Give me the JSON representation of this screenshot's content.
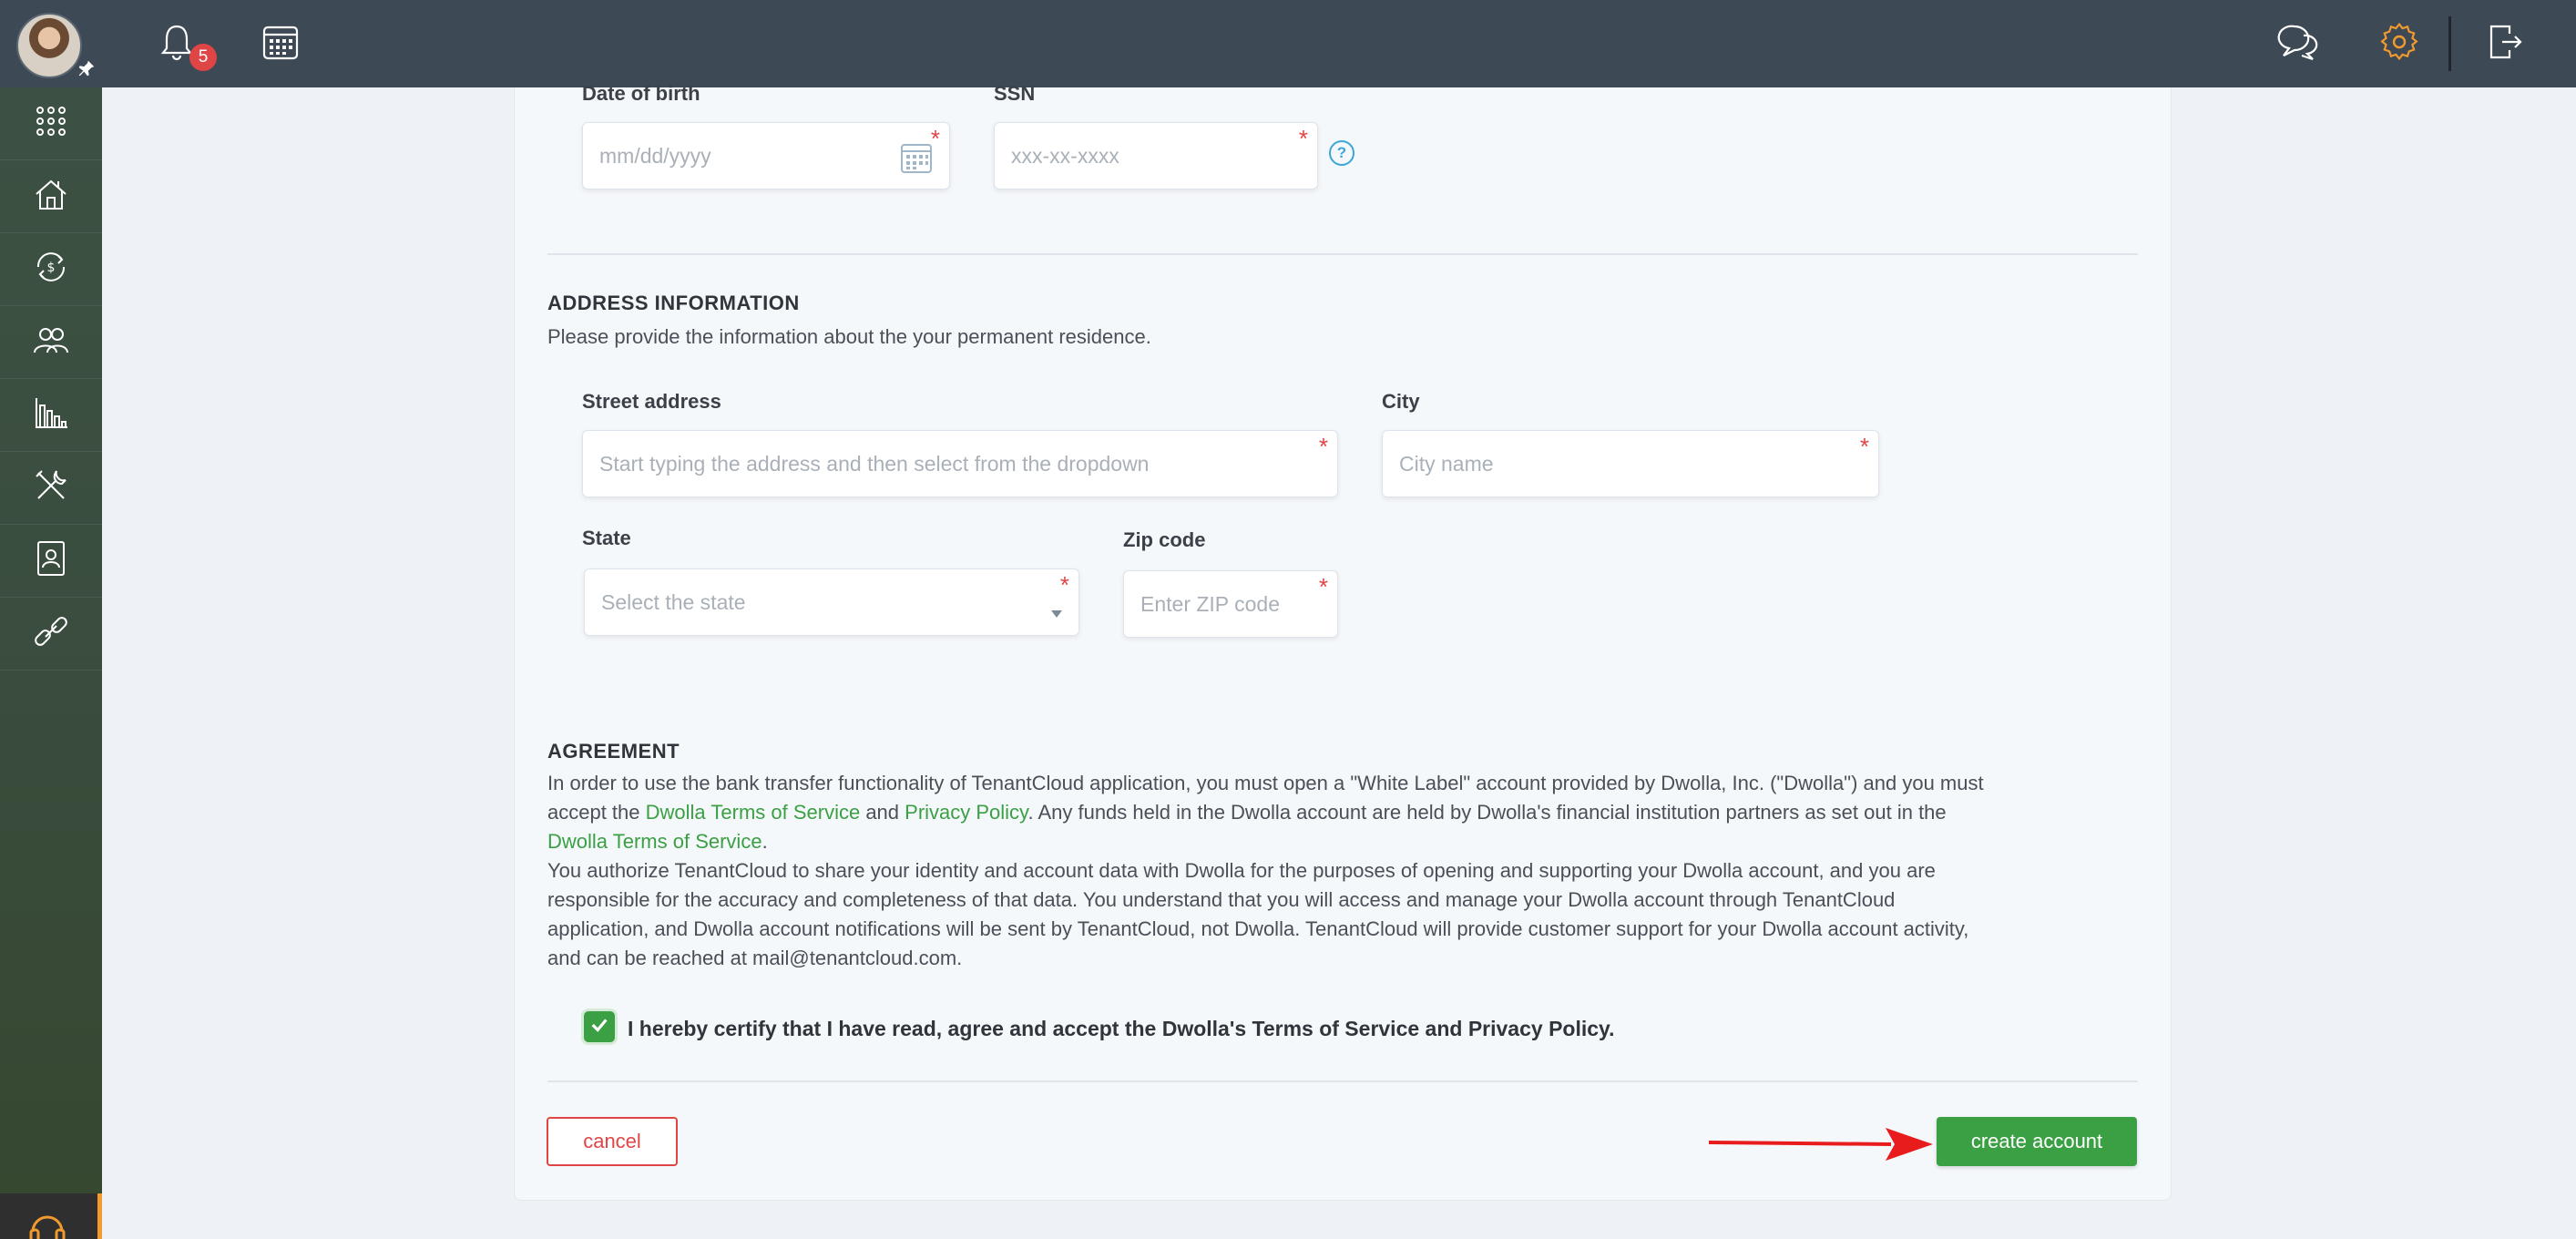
{
  "topbar": {
    "notifications_count": "5",
    "icons": [
      "bell-icon",
      "calendar-icon",
      "chat-icon",
      "gear-icon",
      "logout-icon"
    ]
  },
  "sidebar": {
    "items": [
      "apps-grid-icon",
      "properties-icon",
      "payments-icon",
      "contacts-icon",
      "reports-icon",
      "maintenance-icon",
      "documents-icon",
      "links-icon"
    ]
  },
  "personal": {
    "dob_label": "Date of birth",
    "dob_placeholder": "mm/dd/yyyy",
    "ssn_label": "SSN",
    "ssn_placeholder": "xxx-xx-xxxx",
    "ssn_help": "?"
  },
  "address": {
    "title": "ADDRESS INFORMATION",
    "description": "Please provide the information about the your permanent residence.",
    "street_label": "Street address",
    "street_placeholder": "Start typing the address and then select from the dropdown",
    "city_label": "City",
    "city_placeholder": "City name",
    "state_label": "State",
    "state_placeholder": "Select the state",
    "zip_label": "Zip code",
    "zip_placeholder": "Enter ZIP code"
  },
  "agreement": {
    "title": "AGREEMENT",
    "p1_a": "In order to use the bank transfer functionality of TenantCloud application, you must open a \"White Label\" account provided by Dwolla, Inc. (\"Dwolla\") and you must",
    "p1_b_pre": "accept the ",
    "p1_b_link1": "Dwolla Terms of Service",
    "p1_b_mid": " and ",
    "p1_b_link2": "Privacy Policy",
    "p1_b_post": ". Any funds held in the Dwolla account are held by Dwolla's financial institution partners as set out in the",
    "p1_c_link": "Dwolla Terms of Service",
    "p1_c_post": ".",
    "p2_a": "You authorize TenantCloud to share your identity and account data with Dwolla for the purposes of opening and supporting your Dwolla account, and you are",
    "p2_b": "responsible for the accuracy and completeness of that data. You understand that you will access and manage your Dwolla account through TenantCloud",
    "p2_c": "application, and Dwolla account notifications will be sent by TenantCloud, not Dwolla. TenantCloud will provide customer support for your Dwolla account activity,",
    "p2_d": "and can be reached at mail@tenantcloud.com.",
    "certify_label": "I hereby certify that I have read, agree and accept the Dwolla's Terms of Service and Privacy Policy.",
    "certify_checked": true
  },
  "actions": {
    "cancel_label": "cancel",
    "create_label": "create account"
  },
  "colors": {
    "accent_green": "#3aa043",
    "danger_red": "#e04545",
    "topbar": "#3d4955",
    "settings_orange": "#f29a2e"
  }
}
